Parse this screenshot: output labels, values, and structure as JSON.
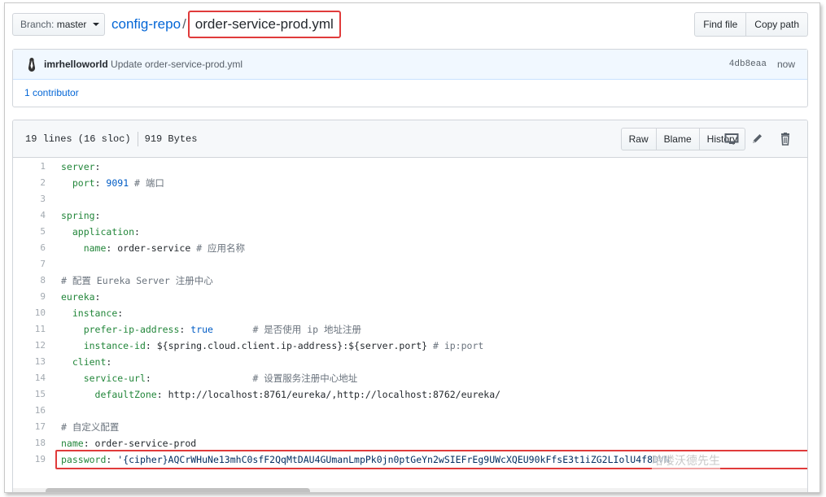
{
  "topbar": {
    "branch_label": "Branch:",
    "branch_value": "master",
    "repo": "config-repo",
    "separator": "/",
    "file": "order-service-prod.yml",
    "find_file": "Find file",
    "copy_path": "Copy path"
  },
  "commit": {
    "author": "imrhelloworld",
    "message": "Update order-service-prod.yml",
    "sha": "4db8eaa",
    "time": "now",
    "contributors": "1 contributor"
  },
  "file": {
    "lines_info": "19 lines (16 sloc)",
    "size": "919 Bytes",
    "raw": "Raw",
    "blame": "Blame",
    "history": "History",
    "icons": [
      "desktop-icon",
      "pencil-icon",
      "trash-icon"
    ]
  },
  "code_lines": [
    "server:",
    "  port: 9091 # 端口",
    "",
    "spring:",
    "  application:",
    "    name: order-service # 应用名称",
    "",
    "# 配置 Eureka Server 注册中心",
    "eureka:",
    "  instance:",
    "    prefer-ip-address: true       # 是否使用 ip 地址注册",
    "    instance-id: ${spring.cloud.client.ip-address}:${server.port} # ip:port",
    "  client:",
    "    service-url:                  # 设置服务注册中心地址",
    "      defaultZone: http://localhost:8761/eureka/,http://localhost:8762/eureka/",
    "",
    "# 自定义配置",
    "name: order-service-prod",
    "password: '{cipher}AQCrWHuNe13mhC0sfF2QqMtDAU4GUmanLmpPk0jn0ptGeYn2wSIEFrEg9UWcXQEU90kFfsE3t1iZG2LIolU4f8DVN"
  ],
  "watermark": "哈喽沃德先生"
}
